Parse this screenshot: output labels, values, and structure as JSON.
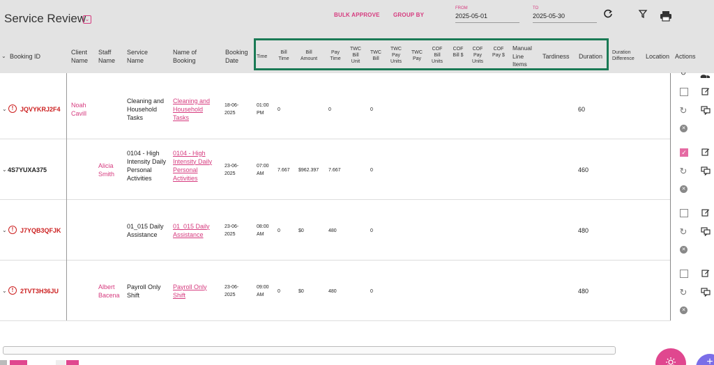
{
  "header": {
    "title": "Service Review",
    "bulk_approve": "BULK APPROVE",
    "group_by": "GROUP BY",
    "from_label": "FROM",
    "from_value": "2025-05-01",
    "to_label": "TO",
    "to_value": "2025-05-30"
  },
  "columns": {
    "booking_id": "Booking ID",
    "client_name": "Client Name",
    "staff_name": "Staff Name",
    "service_name": "Service Name",
    "name_of_booking": "Name of Booking",
    "booking_date": "Booking Date",
    "time": "Time",
    "bill_time": "Bill Time",
    "bill_amount": "Bill Amount",
    "pay_time": "Pay Time",
    "twc_bill_unit": "TWC Bill Unit",
    "twc_bill": "TWC Bill",
    "twc_pay_units": "TWC Pay Units",
    "twc_pay": "TWC Pay",
    "cof_bill_units": "COF Bill Units",
    "cof_bill_dollar": "COF Bill $",
    "cof_pay_units": "COF Pay Units",
    "cof_pay_dollar": "COF Pay $",
    "manual_line_items": "Manual Line Items",
    "tardiness": "Tardiness",
    "duration": "Duration",
    "duration_difference": "Duration Difference",
    "location": "Location",
    "actions": "Actions"
  },
  "rows": [
    {
      "booking_id": "JQVYKRJ2F4",
      "alert": true,
      "client": "Noah Cavill",
      "staff": "",
      "service": "Cleaning and Household Tasks",
      "booking_name": "Cleaning and Household Tasks",
      "date": "18-06-2025",
      "time": "01:00 PM",
      "bill_time": "0",
      "bill_amount": "",
      "pay_time": "0",
      "twc_bill": "0",
      "duration": "60",
      "checked": false
    },
    {
      "booking_id": "4S7YUXA375",
      "alert": false,
      "client": "",
      "staff": "Alicia Smith",
      "service": "0104 - High Intensity Daily Personal Activities",
      "booking_name": "0104 - High Intensity Daily Personal Activities",
      "date": "23-06-2025",
      "time": "07:00 AM",
      "bill_time": "7.667",
      "bill_amount": "$962.397",
      "pay_time": "7.667",
      "twc_bill": "0",
      "duration": "460",
      "checked": true
    },
    {
      "booking_id": "J7YQB3QFJK",
      "alert": true,
      "client": "",
      "staff": "",
      "service": "01_015 Daily Assistance",
      "booking_name": "01_015 Daily Assistance",
      "date": "23-06-2025",
      "time": "08:00 AM",
      "bill_time": "0",
      "bill_amount": "$0",
      "pay_time": "480",
      "twc_bill": "0",
      "duration": "480",
      "checked": false
    },
    {
      "booking_id": "2TVT3H36JU",
      "alert": true,
      "client": "",
      "staff": "Albert Bacena",
      "service": "Payroll Only Shift",
      "booking_name": "Payroll Only Shift",
      "date": "23-06-2025",
      "time": "09:00 AM",
      "bill_time": "0",
      "bill_amount": "$0",
      "pay_time": "480",
      "twc_bill": "0",
      "duration": "480",
      "checked": false
    }
  ],
  "icons": {
    "refresh": "refresh-icon",
    "filter": "filter-icon",
    "print": "print-icon",
    "edit": "edit-icon",
    "chat": "chat-icon",
    "close": "close-circle-icon",
    "alert": "alert-circle-icon",
    "expand": "chevron-down-icon"
  },
  "colors": {
    "accent": "#d63a7e",
    "highlight_box": "#1a7a55",
    "alert": "#cc1f1f",
    "fab_primary": "#e0478f",
    "fab_secondary": "#7b6ee8"
  }
}
